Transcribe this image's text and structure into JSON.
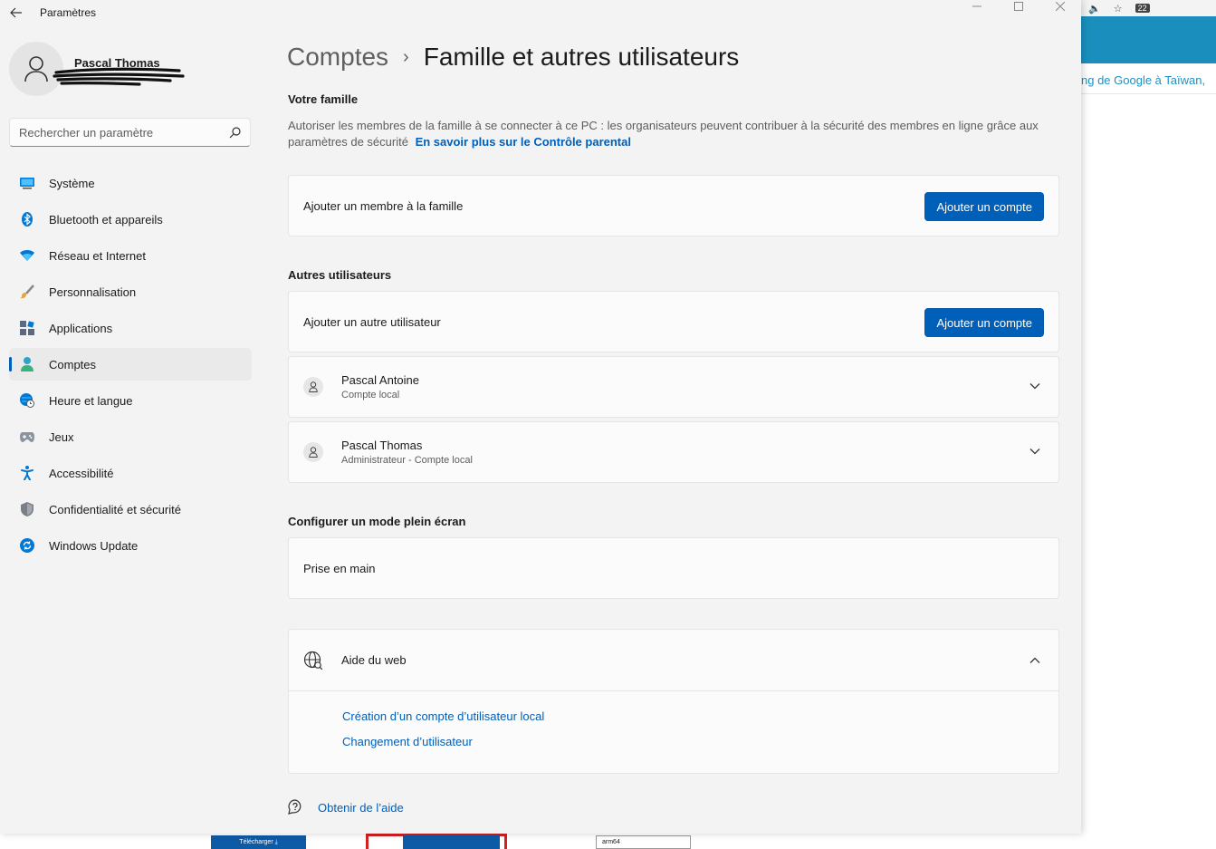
{
  "window": {
    "app_title": "Paramètres"
  },
  "profile": {
    "name": "Pascal Thomas"
  },
  "search": {
    "placeholder": "Rechercher un paramètre"
  },
  "nav": {
    "items": [
      {
        "label": "Système",
        "icon": "monitor-icon"
      },
      {
        "label": "Bluetooth et appareils",
        "icon": "bluetooth-icon"
      },
      {
        "label": "Réseau et Internet",
        "icon": "wifi-icon"
      },
      {
        "label": "Personnalisation",
        "icon": "brush-icon"
      },
      {
        "label": "Applications",
        "icon": "apps-icon"
      },
      {
        "label": "Comptes",
        "icon": "person-icon",
        "active": true
      },
      {
        "label": "Heure et langue",
        "icon": "globe-clock-icon"
      },
      {
        "label": "Jeux",
        "icon": "gamepad-icon"
      },
      {
        "label": "Accessibilité",
        "icon": "accessibility-icon"
      },
      {
        "label": "Confidentialité et sécurité",
        "icon": "shield-icon"
      },
      {
        "label": "Windows Update",
        "icon": "update-icon"
      }
    ]
  },
  "breadcrumb": {
    "parent": "Comptes",
    "separator": "›",
    "current": "Famille et autres utilisateurs"
  },
  "family": {
    "title": "Votre famille",
    "description": "Autoriser les membres de la famille à se connecter à ce PC : les organisateurs peuvent contribuer à la sécurité des membres en ligne grâce aux paramètres de sécurité",
    "link": "En savoir plus sur le Contrôle parental",
    "add_label": "Ajouter un membre à la famille",
    "add_button": "Ajouter un compte"
  },
  "others": {
    "title": "Autres utilisateurs",
    "add_label": "Ajouter un autre utilisateur",
    "add_button": "Ajouter un compte",
    "users": [
      {
        "name": "Pascal Antoine",
        "type": "Compte local"
      },
      {
        "name": "Pascal Thomas",
        "type": "Administrateur - Compte local"
      }
    ]
  },
  "kiosk": {
    "title": "Configurer un mode plein écran",
    "label": "Prise en main"
  },
  "web_help": {
    "title": "Aide du web",
    "links": [
      "Création d’un compte d’utilisateur local",
      "Changement d’utilisateur"
    ]
  },
  "footer": {
    "get_help": "Obtenir de l’aide"
  },
  "background": {
    "link_text": "ng de Google à Taïwan,",
    "badge": "22",
    "download_label": "Télécharger ⤓",
    "arch_label": "arm64"
  },
  "colors": {
    "accent": "#005fb8",
    "window_bg": "#f3f3f3",
    "card_bg": "#fbfbfb",
    "browser_teal": "#1a8fbd"
  }
}
